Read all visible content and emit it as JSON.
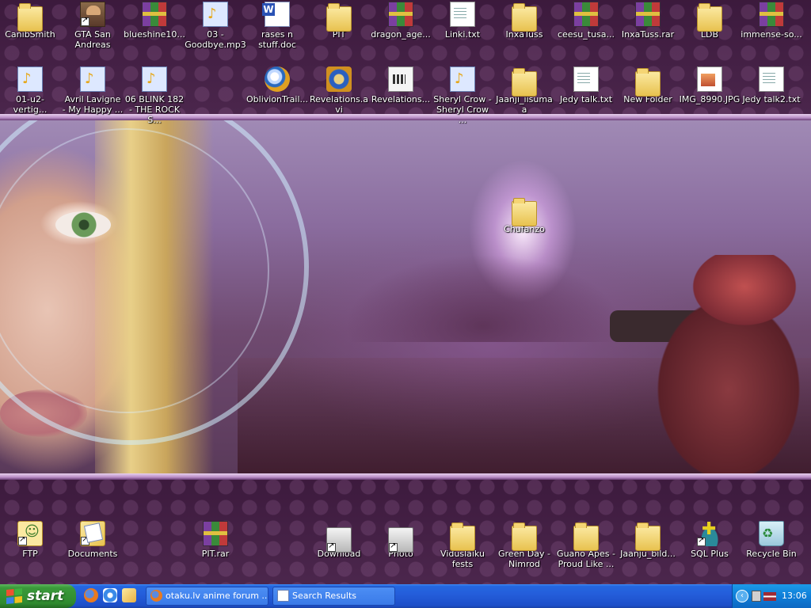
{
  "desktop": {
    "row1": [
      {
        "label": "CanibSmith",
        "kind": "folder"
      },
      {
        "label": "GTA San Andreas",
        "kind": "avatar",
        "shortcut": true
      },
      {
        "label": "blueshine10...",
        "kind": "rar"
      },
      {
        "label": "03 - Goodbye.mp3",
        "kind": "audio"
      },
      {
        "label": "rases n stuff.doc",
        "kind": "doc"
      },
      {
        "label": "PIT",
        "kind": "folder"
      },
      {
        "label": "dragon_age...",
        "kind": "rar"
      },
      {
        "label": "Linki.txt",
        "kind": "file"
      },
      {
        "label": "InxaTuss",
        "kind": "folder"
      },
      {
        "label": "ceesu_tusa...",
        "kind": "rar"
      },
      {
        "label": "InxaTuss.rar",
        "kind": "rar"
      },
      {
        "label": "LDB",
        "kind": "folder"
      },
      {
        "label": "immense-so...",
        "kind": "rar"
      }
    ],
    "row2": [
      {
        "label": "01-u2-vertig...",
        "kind": "audio"
      },
      {
        "label": "Avril Lavigne - My Happy ...",
        "kind": "audio"
      },
      {
        "label": "06 BLINK 182 - THE ROCK S...",
        "kind": "audio"
      },
      {
        "label": "OblivionTrail...",
        "kind": "player"
      },
      {
        "label": "Revelations.avi",
        "kind": "xvid"
      },
      {
        "label": "Revelations...",
        "kind": "video"
      },
      {
        "label": "Sheryl Crow - Sheryl Crow ...",
        "kind": "audio"
      },
      {
        "label": "Jaanji_iisumaa",
        "kind": "folder"
      },
      {
        "label": "Jedy talk.txt",
        "kind": "file"
      },
      {
        "label": "New Folder",
        "kind": "folder"
      },
      {
        "label": "IMG_8990.JPG",
        "kind": "jpg"
      },
      {
        "label": "Jedy talk2.txt",
        "kind": "file"
      }
    ],
    "middle_icon": {
      "label": "Chufanzo",
      "kind": "folder"
    },
    "bottom_row": [
      {
        "label": "FTP",
        "kind": "ftp",
        "shortcut": true
      },
      {
        "label": "Documents",
        "kind": "docs",
        "shortcut": true
      },
      {
        "label": "PIT.rar",
        "kind": "rar"
      },
      {
        "label": "Download",
        "kind": "drive",
        "shortcut": true
      },
      {
        "label": "Photo",
        "kind": "drive",
        "shortcut": true
      },
      {
        "label": "Viduslaiku fests",
        "kind": "folder"
      },
      {
        "label": "Green Day - Nimrod",
        "kind": "folder"
      },
      {
        "label": "Guano Apes - Proud Like ...",
        "kind": "folder"
      },
      {
        "label": "Jaanju_bild...",
        "kind": "folder"
      },
      {
        "label": "SQL Plus",
        "kind": "sql",
        "shortcut": true
      },
      {
        "label": "Recycle Bin",
        "kind": "bin"
      }
    ]
  },
  "taskbar": {
    "start_label": "start",
    "quick_launch": [
      "firefox-icon",
      "internet-explorer-icon",
      "media-player-icon"
    ],
    "tasks": [
      {
        "label": "otaku.lv anime forum ...",
        "icon": "firefox-icon"
      },
      {
        "label": "Search Results",
        "icon": "search-icon"
      }
    ],
    "tray_arrow": "‹",
    "clock": "13:06"
  },
  "colors": {
    "taskbar_blue": "#245edb",
    "start_green": "#3a9a3a",
    "tray_blue": "#0f7ed8"
  }
}
